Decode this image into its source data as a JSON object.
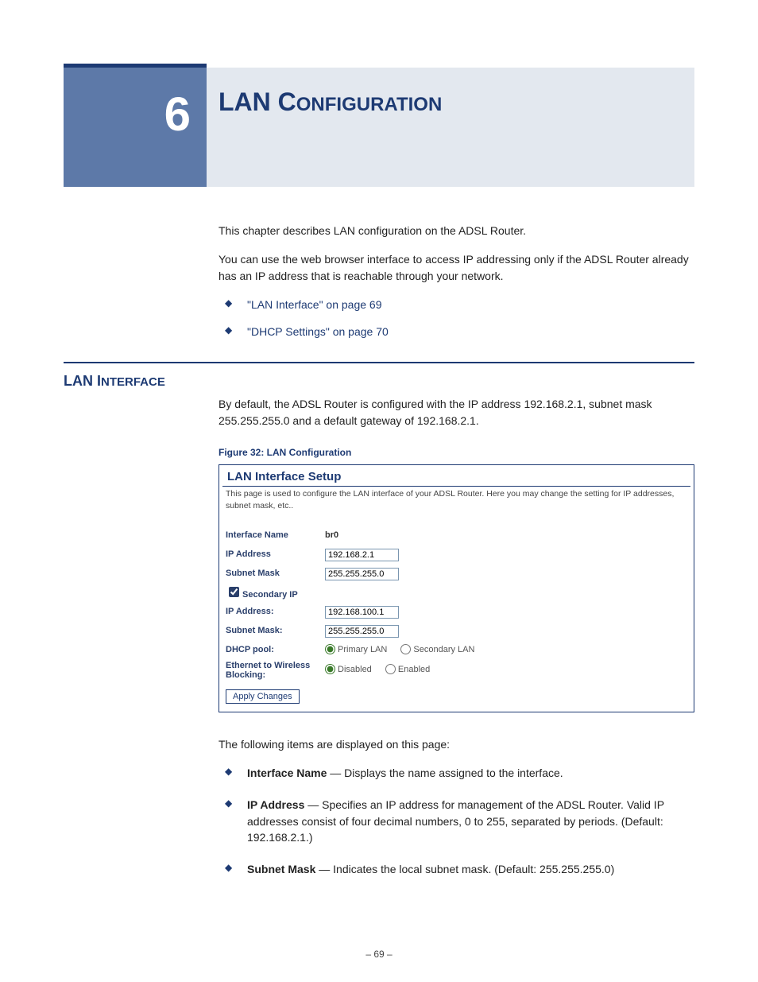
{
  "chapter": {
    "number": "6",
    "title_main": "LAN C",
    "title_rest": "ONFIGURATION"
  },
  "intro": {
    "p1": "This chapter describes LAN configuration on the ADSL Router.",
    "p2": "You can use the web browser interface to access IP addressing only if the ADSL Router already has an IP address that is reachable through your network."
  },
  "toc": [
    {
      "text": "\"LAN Interface\" on page 69"
    },
    {
      "text": "\"DHCP Settings\" on page 70"
    }
  ],
  "section": {
    "head_main": "LAN I",
    "head_rest": "NTERFACE",
    "p1": "By default, the ADSL Router is configured with the IP address 192.168.2.1, subnet mask 255.255.255.0 and a default gateway of 192.168.2.1."
  },
  "figure": {
    "caption": "Figure 32:  LAN Configuration"
  },
  "screenshot": {
    "title": "LAN Interface Setup",
    "desc": "This page is used to configure the LAN interface of your ADSL Router. Here you may change the setting for IP addresses, subnet mask, etc..",
    "labels": {
      "interface_name": "Interface Name",
      "ip_address": "IP Address",
      "subnet_mask": "Subnet Mask",
      "secondary_ip": "Secondary IP",
      "ip_address2": "IP Address:",
      "subnet_mask2": "Subnet Mask:",
      "dhcp_pool": "DHCP pool:",
      "eth_wifi_block": "Ethernet to Wireless Blocking:"
    },
    "values": {
      "interface_name": "br0",
      "ip_address": "192.168.2.1",
      "subnet_mask": "255.255.255.0",
      "ip_address2": "192.168.100.1",
      "subnet_mask2": "255.255.255.0"
    },
    "radios": {
      "dhcp_primary": "Primary LAN",
      "dhcp_secondary": "Secondary LAN",
      "block_disabled": "Disabled",
      "block_enabled": "Enabled"
    },
    "button": "Apply Changes"
  },
  "items_intro": "The following items are displayed on this page:",
  "items": [
    {
      "name": "Interface Name",
      "desc": " — Displays the name assigned to the interface."
    },
    {
      "name": "IP Address",
      "desc": " — Specifies an IP address for management of the ADSL Router. Valid IP addresses consist of four decimal numbers, 0 to 255, separated by periods. (Default: 192.168.2.1.)"
    },
    {
      "name": "Subnet Mask",
      "desc": " — Indicates the local subnet mask. (Default: 255.255.255.0)"
    }
  ],
  "page_number": "–  69  –"
}
